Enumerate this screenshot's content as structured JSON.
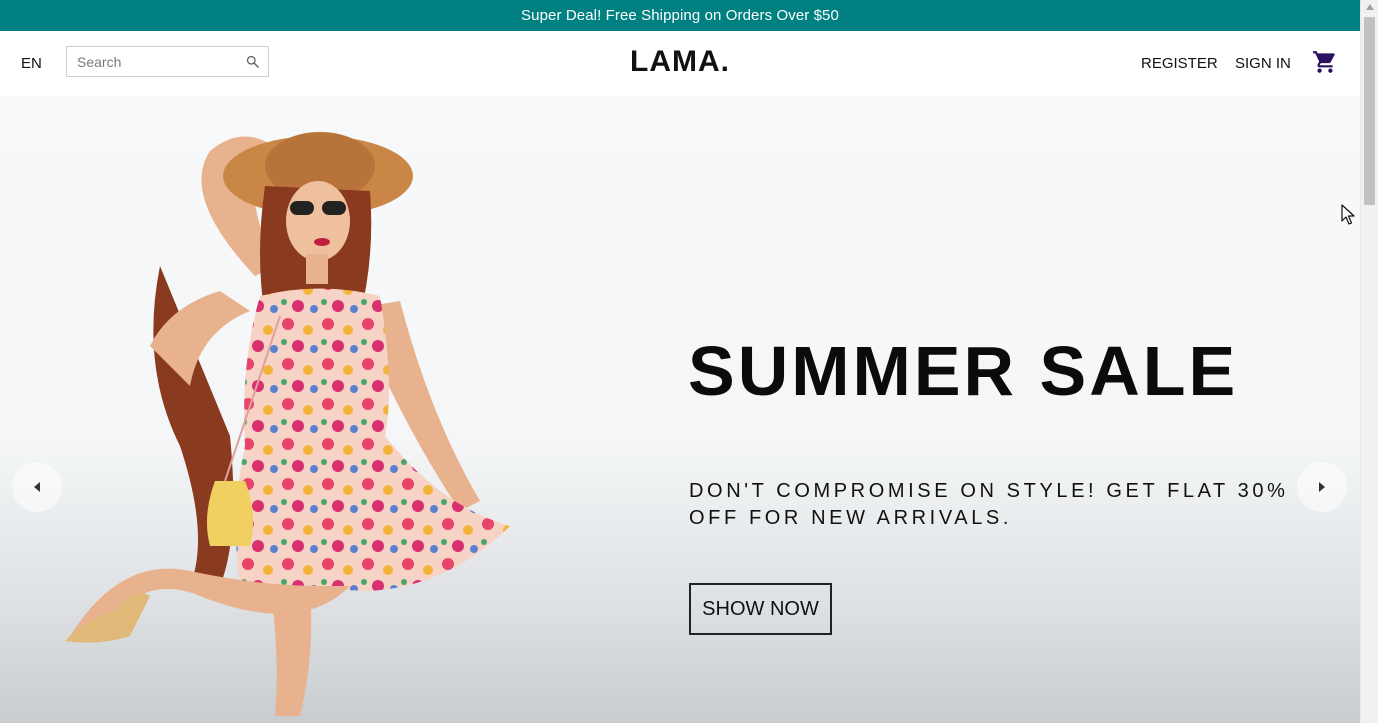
{
  "announcement": {
    "text": "Super Deal! Free Shipping on Orders Over $50",
    "bg_color": "#008080"
  },
  "navbar": {
    "language": "EN",
    "search": {
      "placeholder": "Search",
      "value": "",
      "icon": "search-icon"
    },
    "logo": "LAMA.",
    "menu": {
      "register": "REGISTER",
      "sign_in": "SIGN IN"
    },
    "cart_icon": "shopping-cart-icon",
    "cart_icon_color": "#2a1060"
  },
  "slider": {
    "title": "SUMMER SALE",
    "description": "DON'T COMPROMISE ON STYLE! GET FLAT 30% OFF FOR NEW ARRIVALS.",
    "button": "SHOW NOW",
    "prev_icon": "arrow-left-icon",
    "next_icon": "arrow-right-icon",
    "image": "woman-in-floral-summer-dress"
  },
  "colors": {
    "accent": "#008080",
    "text": "#111111"
  }
}
